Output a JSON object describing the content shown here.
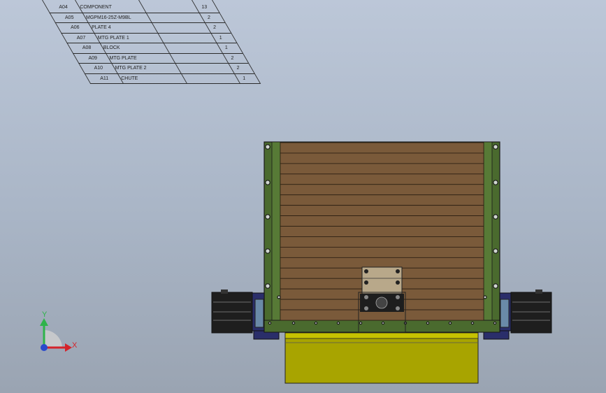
{
  "bom": {
    "rows": [
      {
        "item": "A04",
        "name": "COMPONENT",
        "qty": "13"
      },
      {
        "item": "A05",
        "name": "MGPM16-25Z-M9BL",
        "qty": "2"
      },
      {
        "item": "A06",
        "name": "PLATE 4",
        "qty": "2"
      },
      {
        "item": "A07",
        "name": "MTG PLATE 1",
        "qty": "1"
      },
      {
        "item": "A08",
        "name": "BLOCK",
        "qty": "1"
      },
      {
        "item": "A09",
        "name": "MTG PLATE",
        "qty": "2"
      },
      {
        "item": "A10",
        "name": "MTG PLATE 2",
        "qty": "2"
      },
      {
        "item": "A11",
        "name": "CHUTE",
        "qty": "1"
      }
    ]
  },
  "triad": {
    "y_label": "Y",
    "x_label": "X"
  },
  "colors": {
    "frame_green": "#4a6a2e",
    "plank_brown": "#7a5a3a",
    "chute_yellow": "#a8a400",
    "block_tan": "#b8a88a",
    "base_navy": "#2a2e6a",
    "cylinder_black": "#1e1e1e",
    "axis_x": "#d4232a",
    "axis_y": "#2fb34a",
    "axis_z": "#2a4acb"
  }
}
